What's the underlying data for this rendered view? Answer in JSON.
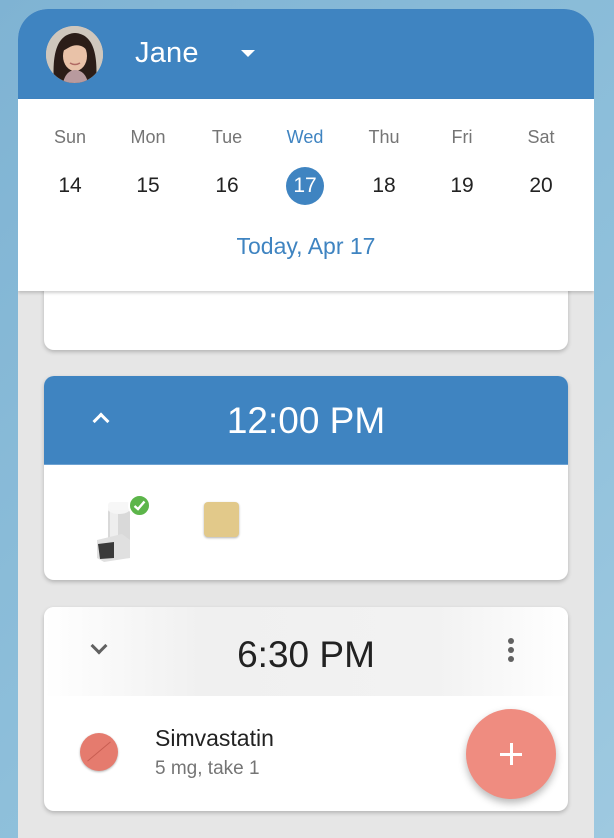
{
  "header": {
    "user_name": "Jane",
    "avatar": "user-avatar-photo",
    "dropdown_icon": "caret-down-icon",
    "accent_color": "#3f84c1"
  },
  "calendar": {
    "days": [
      {
        "dow": "Sun",
        "date": "14",
        "selected": false
      },
      {
        "dow": "Mon",
        "date": "15",
        "selected": false
      },
      {
        "dow": "Tue",
        "date": "16",
        "selected": false
      },
      {
        "dow": "Wed",
        "date": "17",
        "selected": true
      },
      {
        "dow": "Thu",
        "date": "18",
        "selected": false
      },
      {
        "dow": "Fri",
        "date": "19",
        "selected": false
      },
      {
        "dow": "Sat",
        "date": "20",
        "selected": false
      }
    ],
    "today_label": "Today, Apr 17"
  },
  "schedule": [
    {
      "time": "12:00 PM",
      "expanded": true,
      "toggle_icon": "chevron-up-icon",
      "items": [
        {
          "icon": "inhaler-icon",
          "status": "taken",
          "status_icon": "check-badge-icon"
        },
        {
          "icon": "square-pill-icon",
          "color": "#e2c98a"
        }
      ]
    },
    {
      "time": "6:30 PM",
      "expanded": false,
      "toggle_icon": "chevron-down-icon",
      "menu_icon": "more-vertical-icon",
      "items": [
        {
          "icon": "round-pill-icon",
          "color": "#e57b6e",
          "name": "Simvastatin",
          "dose": "5 mg, take 1"
        }
      ]
    }
  ],
  "fab": {
    "icon": "plus-icon",
    "color": "#ef8c80"
  }
}
